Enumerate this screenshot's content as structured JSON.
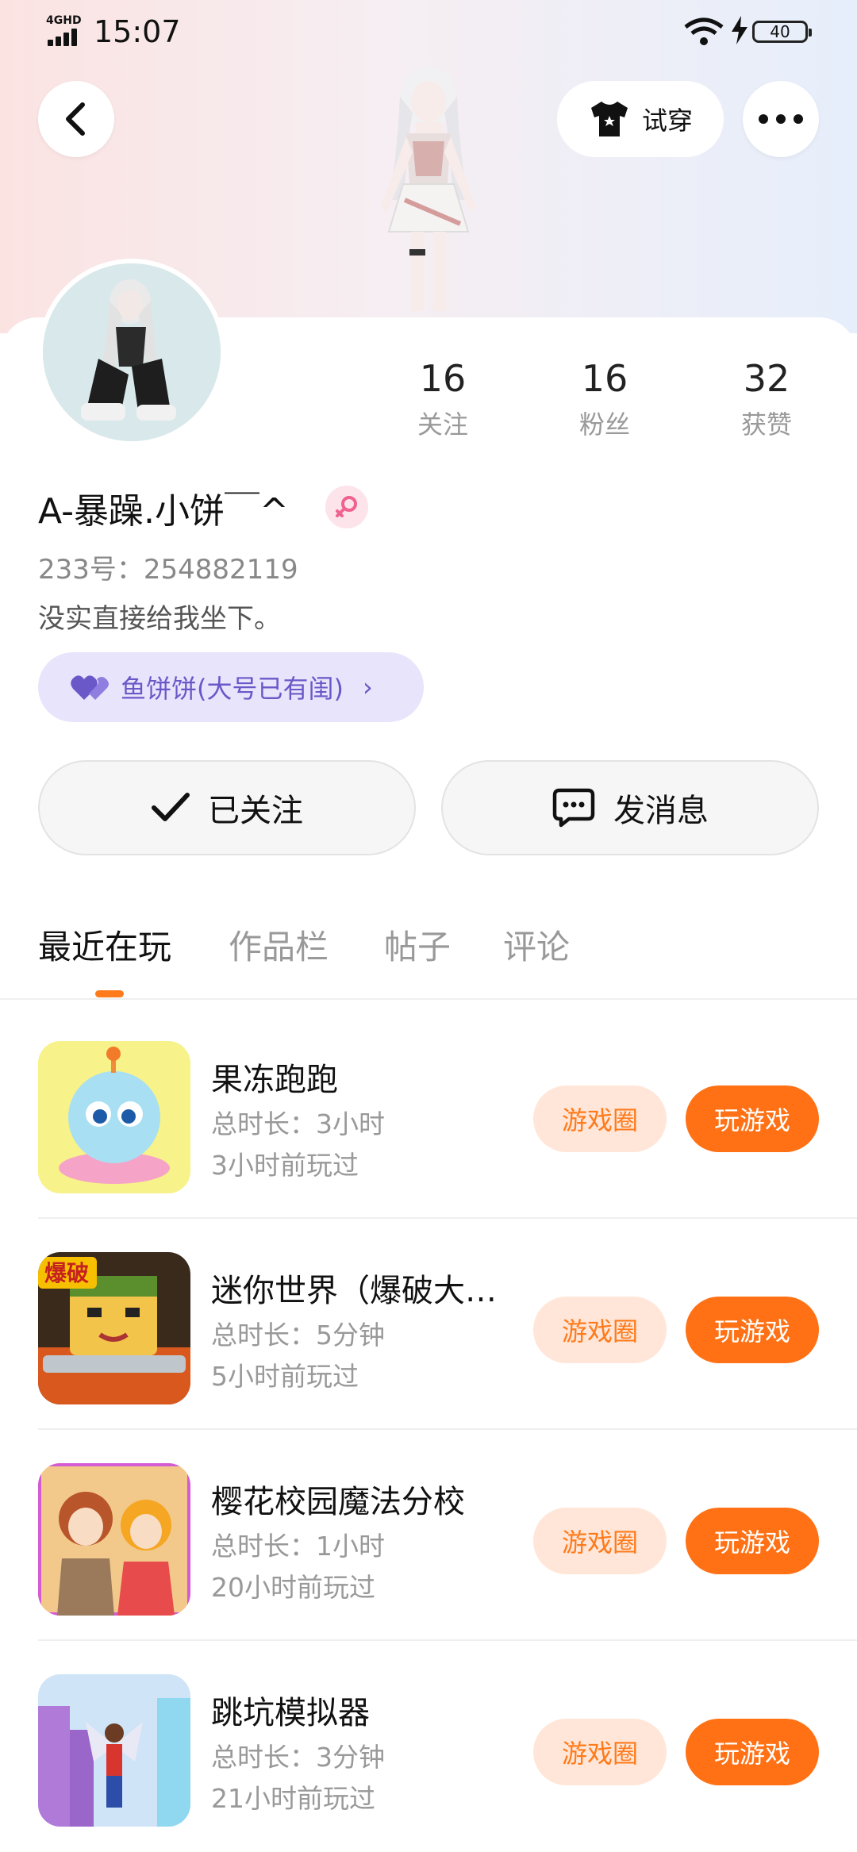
{
  "status_bar": {
    "network": "4GHD",
    "time": "15:07",
    "battery": "40"
  },
  "header": {
    "try_on_label": "试穿"
  },
  "profile": {
    "stats": [
      {
        "value": "16",
        "label": "关注"
      },
      {
        "value": "16",
        "label": "粉丝"
      },
      {
        "value": "32",
        "label": "获赞"
      }
    ],
    "name": "A-暴躁.小饼￣^",
    "uid": "233号：254882119",
    "bio": "没实直接给我坐下。",
    "club": "鱼饼饼(大号已有闺)",
    "follow_label": "已关注",
    "message_label": "发消息"
  },
  "tabs": [
    "最近在玩",
    "作品栏",
    "帖子",
    "评论"
  ],
  "games": [
    {
      "title": "果冻跑跑",
      "duration": "总时长：3小时",
      "last_played": "3小时前玩过",
      "circle_label": "游戏圈",
      "play_label": "玩游戏"
    },
    {
      "title": "迷你世界（爆破大…",
      "duration": "总时长：5分钟",
      "last_played": "5小时前玩过",
      "circle_label": "游戏圈",
      "play_label": "玩游戏"
    },
    {
      "title": " 樱花校园魔法分校",
      "duration": "总时长：1小时",
      "last_played": "20小时前玩过",
      "circle_label": "游戏圈",
      "play_label": "玩游戏"
    },
    {
      "title": "跳坑模拟器",
      "duration": "总时长：3分钟",
      "last_played": "21小时前玩过",
      "circle_label": "游戏圈",
      "play_label": "玩游戏"
    }
  ],
  "colors": {
    "accent": "#ff7114",
    "accent_light": "#ffe6d8",
    "club_bg": "#e8e4fb",
    "club_text": "#6b58c8"
  }
}
